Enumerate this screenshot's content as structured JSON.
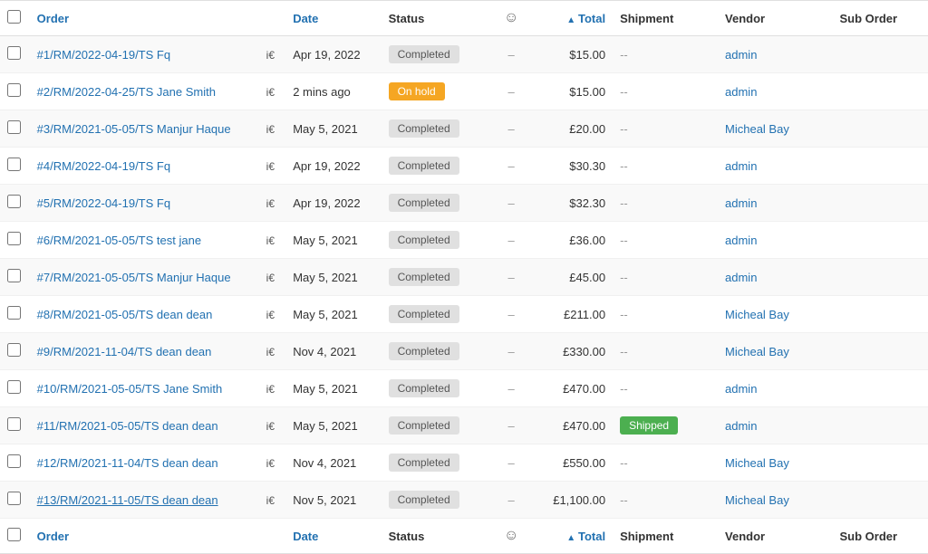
{
  "table": {
    "columns": {
      "order": "Order",
      "date": "Date",
      "status": "Status",
      "total": "Total",
      "shipment": "Shipment",
      "vendor": "Vendor",
      "suborder": "Sub Order"
    },
    "rows": [
      {
        "id": 1,
        "order": "#1/RM/2022-04-19/TS Fq",
        "icon": "i€",
        "date": "Apr 19, 2022",
        "status": "Completed",
        "status_type": "completed",
        "total": "$15.00",
        "shipment": "--",
        "vendor": "admin",
        "suborder": ""
      },
      {
        "id": 2,
        "order": "#2/RM/2022-04-25/TS Jane Smith",
        "icon": "i€",
        "date": "2 mins ago",
        "status": "On hold",
        "status_type": "onhold",
        "total": "$15.00",
        "shipment": "--",
        "vendor": "admin",
        "suborder": ""
      },
      {
        "id": 3,
        "order": "#3/RM/2021-05-05/TS Manjur Haque",
        "icon": "i€",
        "date": "May 5, 2021",
        "status": "Completed",
        "status_type": "completed",
        "total": "£20.00",
        "shipment": "--",
        "vendor": "Micheal Bay",
        "suborder": ""
      },
      {
        "id": 4,
        "order": "#4/RM/2022-04-19/TS Fq",
        "icon": "i€",
        "date": "Apr 19, 2022",
        "status": "Completed",
        "status_type": "completed",
        "total": "$30.30",
        "shipment": "--",
        "vendor": "admin",
        "suborder": ""
      },
      {
        "id": 5,
        "order": "#5/RM/2022-04-19/TS Fq",
        "icon": "i€",
        "date": "Apr 19, 2022",
        "status": "Completed",
        "status_type": "completed",
        "total": "$32.30",
        "shipment": "--",
        "vendor": "admin",
        "suborder": ""
      },
      {
        "id": 6,
        "order": "#6/RM/2021-05-05/TS test jane",
        "icon": "i€",
        "date": "May 5, 2021",
        "status": "Completed",
        "status_type": "completed",
        "total": "£36.00",
        "shipment": "--",
        "vendor": "admin",
        "suborder": ""
      },
      {
        "id": 7,
        "order": "#7/RM/2021-05-05/TS Manjur Haque",
        "icon": "i€",
        "date": "May 5, 2021",
        "status": "Completed",
        "status_type": "completed",
        "total": "£45.00",
        "shipment": "--",
        "vendor": "admin",
        "suborder": ""
      },
      {
        "id": 8,
        "order": "#8/RM/2021-05-05/TS dean dean",
        "icon": "i€",
        "date": "May 5, 2021",
        "status": "Completed",
        "status_type": "completed",
        "total": "£211.00",
        "shipment": "--",
        "vendor": "Micheal Bay",
        "suborder": ""
      },
      {
        "id": 9,
        "order": "#9/RM/2021-11-04/TS dean dean",
        "icon": "i€",
        "date": "Nov 4, 2021",
        "status": "Completed",
        "status_type": "completed",
        "total": "£330.00",
        "shipment": "--",
        "vendor": "Micheal Bay",
        "suborder": ""
      },
      {
        "id": 10,
        "order": "#10/RM/2021-05-05/TS Jane Smith",
        "icon": "i€",
        "date": "May 5, 2021",
        "status": "Completed",
        "status_type": "completed",
        "total": "£470.00",
        "shipment": "--",
        "vendor": "admin",
        "suborder": ""
      },
      {
        "id": 11,
        "order": "#11/RM/2021-05-05/TS dean dean",
        "icon": "i€",
        "date": "May 5, 2021",
        "status": "Completed",
        "status_type": "completed",
        "total": "£470.00",
        "shipment": "Shipped",
        "shipment_type": "shipped",
        "vendor": "admin",
        "suborder": ""
      },
      {
        "id": 12,
        "order": "#12/RM/2021-11-04/TS dean dean",
        "icon": "i€",
        "date": "Nov 4, 2021",
        "status": "Completed",
        "status_type": "completed",
        "total": "£550.00",
        "shipment": "--",
        "vendor": "Micheal Bay",
        "suborder": ""
      },
      {
        "id": 13,
        "order": "#13/RM/2021-11-05/TS dean dean",
        "icon": "i€",
        "date": "Nov 5, 2021",
        "status": "Completed",
        "status_type": "completed",
        "total": "£1,100.00",
        "shipment": "--",
        "vendor": "Micheal Bay",
        "suborder": "",
        "underlined": true
      }
    ]
  }
}
